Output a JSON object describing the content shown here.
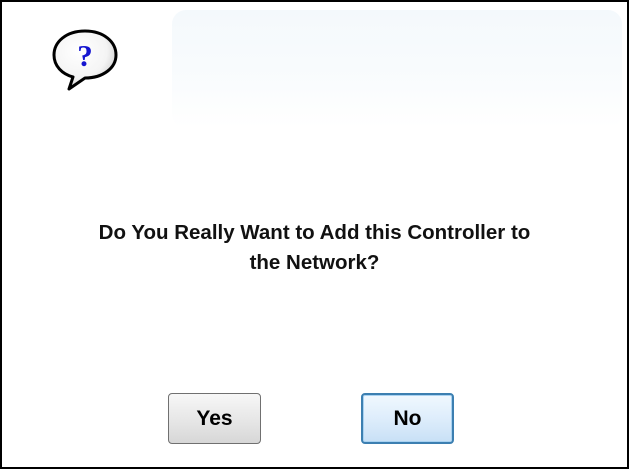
{
  "dialog": {
    "icon": "question-balloon-icon",
    "message_lines": [
      "Do You Really Want to Add this Controller to",
      "the Network?"
    ],
    "buttons": {
      "yes_label": "Yes",
      "no_label": "No"
    }
  },
  "colors": {
    "icon_glyph": "#1515d0",
    "default_button_border": "#3c7fb1"
  }
}
